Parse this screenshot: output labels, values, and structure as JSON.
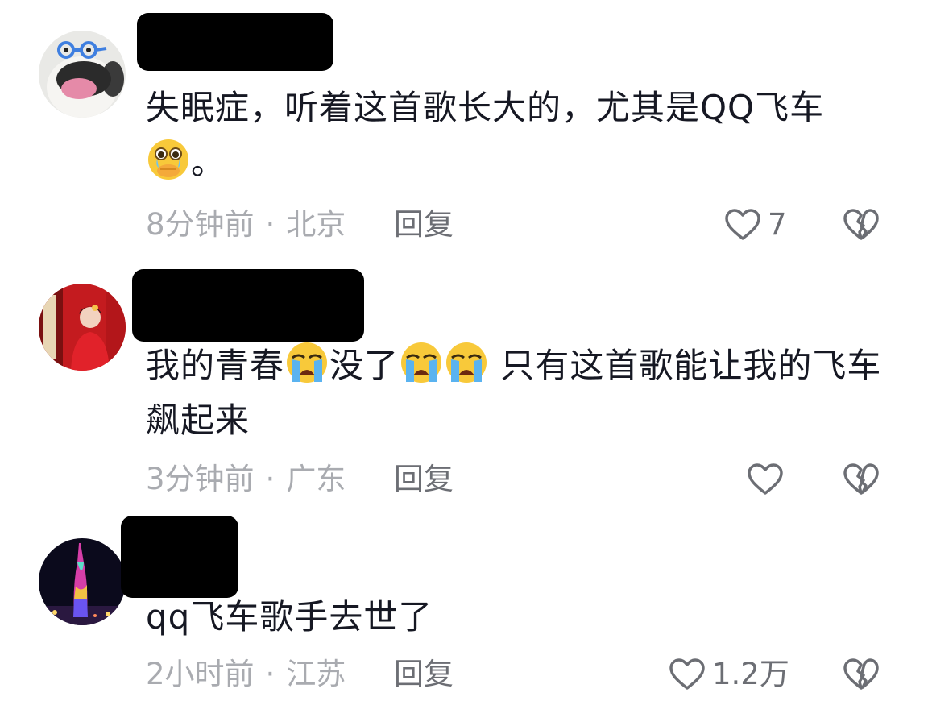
{
  "comments": [
    {
      "text_before": "失眠症，听着这首歌长大的，尤其是QQ飞车",
      "text_after": "。",
      "emoji_1": "hand-over-mouth-tears-emoji",
      "time": "8分钟前",
      "location": "北京",
      "reply_label": "回复",
      "like_count": "7",
      "avatar": "dog-glasses-avatar"
    },
    {
      "text_part1": "我的青春",
      "text_part2": "没了",
      "text_part3": " 只有这首歌能让我的飞车飙起来",
      "emoji_1": "loudly-crying-emoji",
      "time": "3分钟前",
      "location": "广东",
      "reply_label": "回复",
      "like_count": "",
      "avatar": "woman-red-dress-avatar"
    },
    {
      "text": "qq飞车歌手去世了",
      "time": "2小时前",
      "location": "江苏",
      "reply_label": "回复",
      "like_count": "1.2万",
      "avatar": "canton-tower-night-avatar"
    }
  ],
  "separator": "·",
  "icons": {
    "like": "heart-outline-icon",
    "dislike": "broken-heart-icon"
  },
  "colors": {
    "text": "#161823",
    "meta": "#a9abb0",
    "action": "#6c6e74"
  }
}
